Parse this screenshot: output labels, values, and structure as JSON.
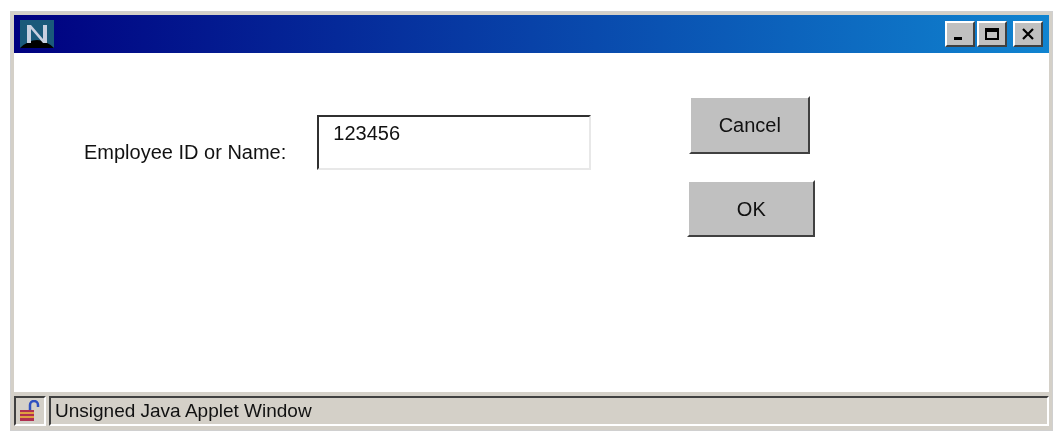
{
  "form": {
    "label": "Employee ID or Name:",
    "value": "123456"
  },
  "buttons": [
    {
      "label": "Cancel"
    },
    {
      "label": "OK"
    }
  ],
  "status_bar": {
    "text": "Unsigned Java Applet Window"
  }
}
